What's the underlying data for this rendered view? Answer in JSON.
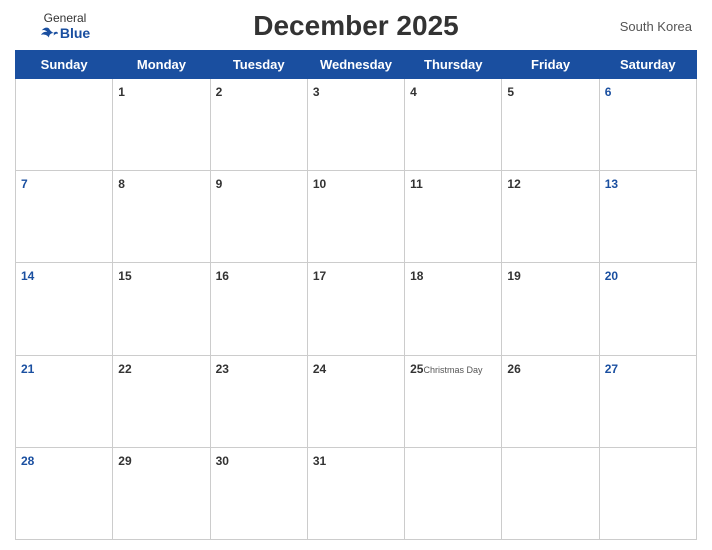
{
  "header": {
    "logo": {
      "general": "General",
      "blue": "Blue"
    },
    "title": "December 2025",
    "region": "South Korea"
  },
  "weekdays": [
    "Sunday",
    "Monday",
    "Tuesday",
    "Wednesday",
    "Thursday",
    "Friday",
    "Saturday"
  ],
  "weeks": [
    [
      {
        "num": "",
        "holiday": "",
        "type": "empty"
      },
      {
        "num": "1",
        "holiday": "",
        "type": "normal"
      },
      {
        "num": "2",
        "holiday": "",
        "type": "normal"
      },
      {
        "num": "3",
        "holiday": "",
        "type": "normal"
      },
      {
        "num": "4",
        "holiday": "",
        "type": "normal"
      },
      {
        "num": "5",
        "holiday": "",
        "type": "normal"
      },
      {
        "num": "6",
        "holiday": "",
        "type": "saturday"
      }
    ],
    [
      {
        "num": "7",
        "holiday": "",
        "type": "sunday"
      },
      {
        "num": "8",
        "holiday": "",
        "type": "normal"
      },
      {
        "num": "9",
        "holiday": "",
        "type": "normal"
      },
      {
        "num": "10",
        "holiday": "",
        "type": "normal"
      },
      {
        "num": "11",
        "holiday": "",
        "type": "normal"
      },
      {
        "num": "12",
        "holiday": "",
        "type": "normal"
      },
      {
        "num": "13",
        "holiday": "",
        "type": "saturday"
      }
    ],
    [
      {
        "num": "14",
        "holiday": "",
        "type": "sunday"
      },
      {
        "num": "15",
        "holiday": "",
        "type": "normal"
      },
      {
        "num": "16",
        "holiday": "",
        "type": "normal"
      },
      {
        "num": "17",
        "holiday": "",
        "type": "normal"
      },
      {
        "num": "18",
        "holiday": "",
        "type": "normal"
      },
      {
        "num": "19",
        "holiday": "",
        "type": "normal"
      },
      {
        "num": "20",
        "holiday": "",
        "type": "saturday"
      }
    ],
    [
      {
        "num": "21",
        "holiday": "",
        "type": "sunday"
      },
      {
        "num": "22",
        "holiday": "",
        "type": "normal"
      },
      {
        "num": "23",
        "holiday": "",
        "type": "normal"
      },
      {
        "num": "24",
        "holiday": "",
        "type": "normal"
      },
      {
        "num": "25",
        "holiday": "Christmas Day",
        "type": "normal"
      },
      {
        "num": "26",
        "holiday": "",
        "type": "normal"
      },
      {
        "num": "27",
        "holiday": "",
        "type": "saturday"
      }
    ],
    [
      {
        "num": "28",
        "holiday": "",
        "type": "sunday"
      },
      {
        "num": "29",
        "holiday": "",
        "type": "normal"
      },
      {
        "num": "30",
        "holiday": "",
        "type": "normal"
      },
      {
        "num": "31",
        "holiday": "",
        "type": "normal"
      },
      {
        "num": "",
        "holiday": "",
        "type": "empty"
      },
      {
        "num": "",
        "holiday": "",
        "type": "empty"
      },
      {
        "num": "",
        "holiday": "",
        "type": "empty"
      }
    ]
  ]
}
